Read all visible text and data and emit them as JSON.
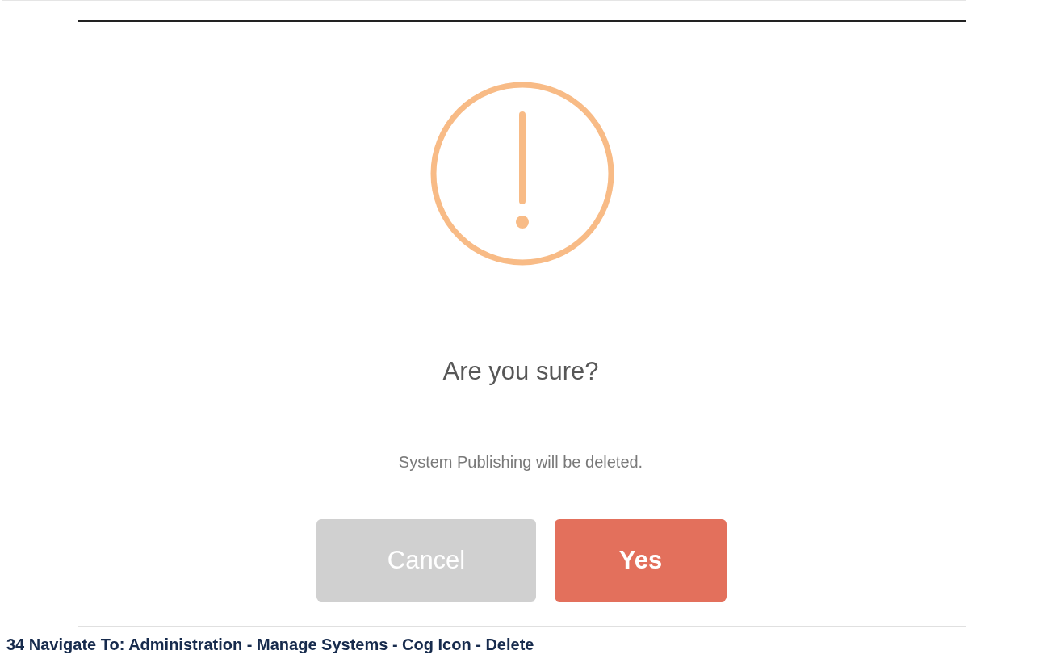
{
  "dialog": {
    "title": "Are you sure?",
    "message": "System Publishing will be deleted.",
    "buttons": [
      {
        "label": "Cancel",
        "kind": "cancel"
      },
      {
        "label": "Yes",
        "kind": "confirm"
      }
    ]
  },
  "caption": "34 Navigate To: Administration - Manage Systems - Cog Icon - Delete"
}
